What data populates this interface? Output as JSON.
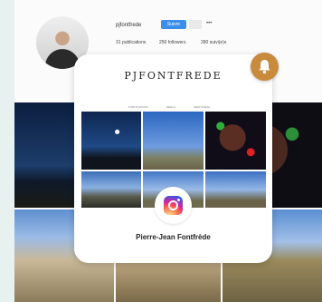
{
  "background_profile": {
    "username": "pjfontfrede",
    "follow_label": "Suivre",
    "more_icon": "dots-horizontal-icon",
    "stats": [
      {
        "label": "31 publications"
      },
      {
        "label": "250 followers"
      },
      {
        "label": "280 suivi(e)s"
      }
    ]
  },
  "card": {
    "brand": "PJFONTFREDE",
    "mini_tabs": [
      "PUBLICATIONS",
      "REELS",
      "IDENTIFIÉ(E)"
    ],
    "icon": "instagram-icon",
    "name": "Pierre-Jean Fontfrède"
  },
  "bell": {
    "icon": "bell-icon",
    "color": "#c98a3c"
  },
  "colors": {
    "follow": "#3b8fe8",
    "background": "#e7f1f0"
  }
}
